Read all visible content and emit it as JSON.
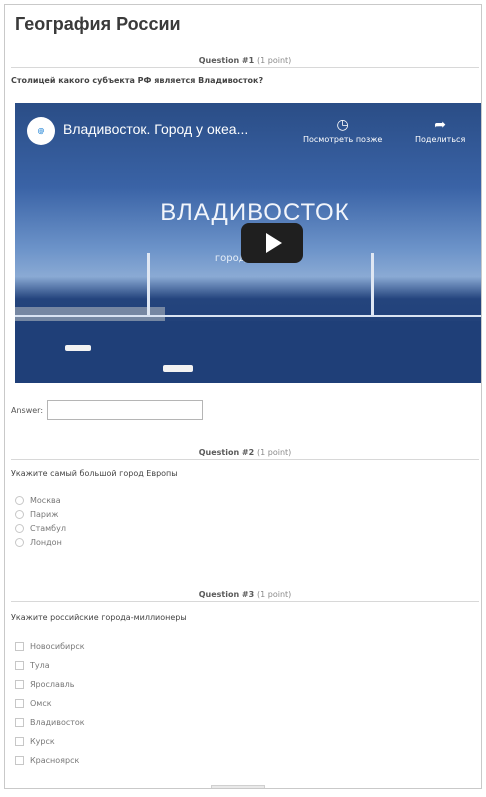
{
  "quiz": {
    "title": "География России"
  },
  "q1": {
    "label": "Question #1",
    "points": "(1 point)",
    "text": "Столицей какого субъекта РФ является Владивосток?",
    "video": {
      "title": "Владивосток. Город у океа...",
      "watch_later": "Посмотреть позже",
      "share": "Поделиться",
      "caption": "ВЛАДИВОСТОК",
      "subcaption": "город у океана"
    },
    "answer_label": "Answer:",
    "answer_value": ""
  },
  "q2": {
    "label": "Question #2",
    "points": "(1 point)",
    "text": "Укажите самый большой город Европы",
    "options": [
      "Москва",
      "Париж",
      "Стамбул",
      "Лондон"
    ]
  },
  "q3": {
    "label": "Question #3",
    "points": "(1 point)",
    "text": "Укажите российские города-миллионеры",
    "options": [
      "Новосибирск",
      "Тула",
      "Ярославль",
      "Омск",
      "Владивосток",
      "Курск",
      "Красноярск"
    ]
  },
  "icons": {
    "watch_later": "clock-icon",
    "share": "share-arrow-icon",
    "play": "play-icon"
  }
}
